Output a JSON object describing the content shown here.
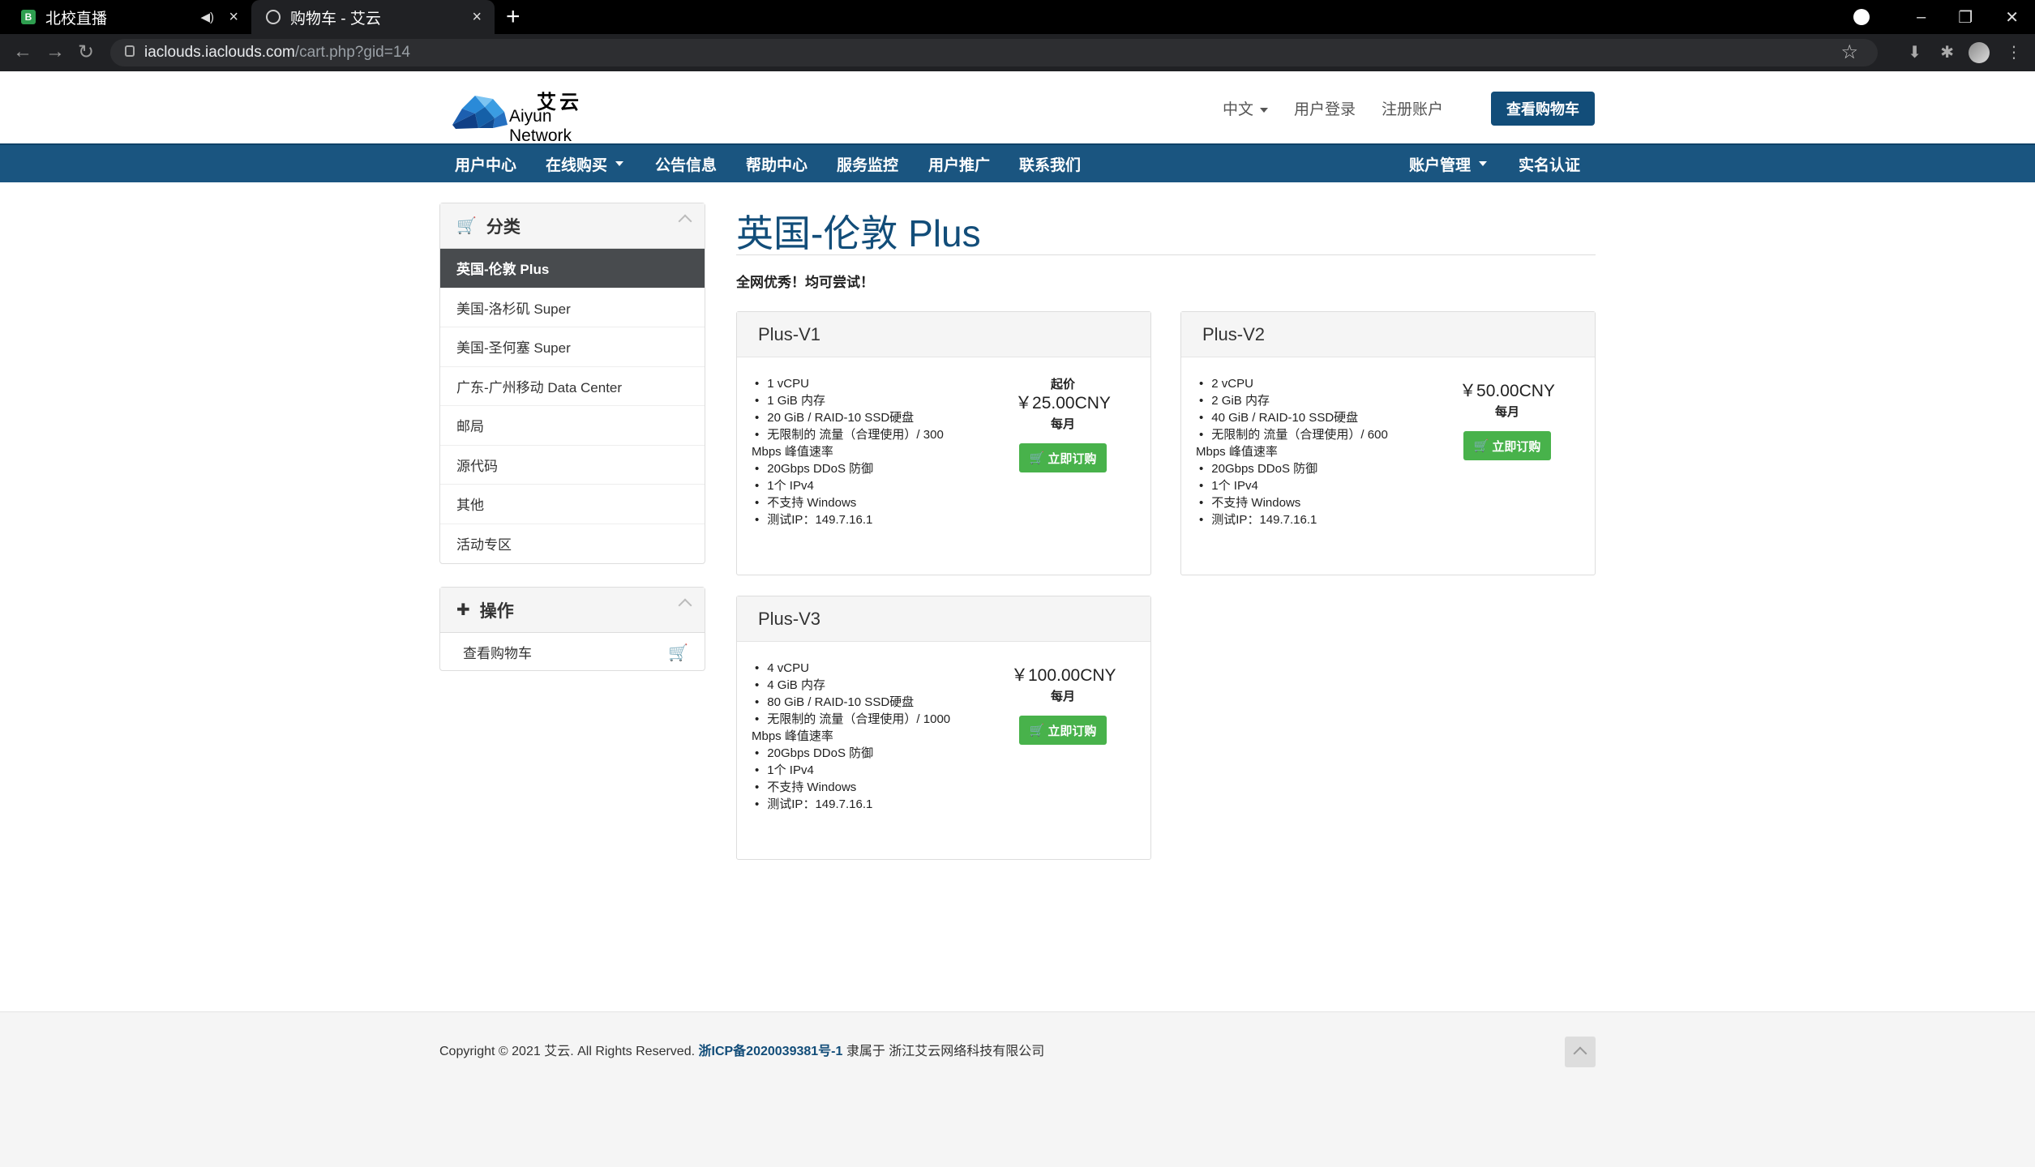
{
  "browser": {
    "tabs": [
      {
        "title": "北校直播"
      },
      {
        "title": "购物车 - 艾云"
      }
    ],
    "url_host": "iaclouds.iaclouds.com",
    "url_path": "/cart.php?gid=14"
  },
  "header": {
    "logo_cn": "艾云",
    "logo_en": "Aiyun Network",
    "language": "中文",
    "login": "用户登录",
    "register": "注册账户",
    "view_cart": "查看购物车"
  },
  "nav": {
    "user_center": "用户中心",
    "buy_online": "在线购买",
    "announcements": "公告信息",
    "help_center": "帮助中心",
    "service_monitor": "服务监控",
    "user_promo": "用户推广",
    "contact": "联系我们",
    "account_manage": "账户管理",
    "verification": "实名认证"
  },
  "sidebar": {
    "categories_title": "分类",
    "categories": [
      {
        "label": "英国-伦敦 Plus",
        "active": true
      },
      {
        "label": "美国-洛杉矶 Super"
      },
      {
        "label": "美国-圣何塞 Super"
      },
      {
        "label": "广东-广州移动 Data Center"
      },
      {
        "label": "邮局"
      },
      {
        "label": "源代码"
      },
      {
        "label": "其他"
      },
      {
        "label": "活动专区"
      }
    ],
    "actions_title": "操作",
    "actions": [
      {
        "label": "查看购物车"
      }
    ]
  },
  "main": {
    "title": "英国-伦敦 Plus",
    "tagline": "全网优秀！均可尝试！",
    "order_label": "立即订购",
    "products": [
      {
        "name": "Plus-V1",
        "features": [
          "1 vCPU",
          "1 GiB 内存",
          "20 GiB / RAID-10 SSD硬盘",
          "无限制的 流量（合理使用）/ 300 Mbps 峰值速率",
          "20Gbps DDoS 防御",
          "1个 IPv4",
          "不支持 Windows",
          "测试IP：149.7.16.1"
        ],
        "price_from": "起价",
        "price": "￥25.00CNY",
        "cycle": "每月"
      },
      {
        "name": "Plus-V2",
        "features": [
          "2 vCPU",
          "2 GiB 内存",
          "40 GiB / RAID-10 SSD硬盘",
          "无限制的 流量（合理使用）/ 600 Mbps 峰值速率",
          "20Gbps DDoS 防御",
          "1个 IPv4",
          "不支持 Windows",
          "测试IP：149.7.16.1"
        ],
        "price_from": "",
        "price": "￥50.00CNY",
        "cycle": "每月"
      },
      {
        "name": "Plus-V3",
        "features": [
          "4 vCPU",
          "4 GiB 内存",
          "80 GiB / RAID-10 SSD硬盘",
          "无限制的 流量（合理使用）/ 1000 Mbps 峰值速率",
          "20Gbps DDoS 防御",
          "1个 IPv4",
          "不支持 Windows",
          "测试IP：149.7.16.1"
        ],
        "price_from": "",
        "price": "￥100.00CNY",
        "cycle": "每月"
      }
    ]
  },
  "footer": {
    "copyright": "Copyright © 2021 艾云. All Rights Reserved.",
    "icp": "浙ICP备2020039381号-1",
    "company": "隶属于 浙江艾云网络科技有限公司"
  },
  "colors": {
    "brand_blue": "#124d79",
    "nav_blue": "#1a5580",
    "order_green": "#48b24b",
    "active_category": "#484b4e"
  }
}
